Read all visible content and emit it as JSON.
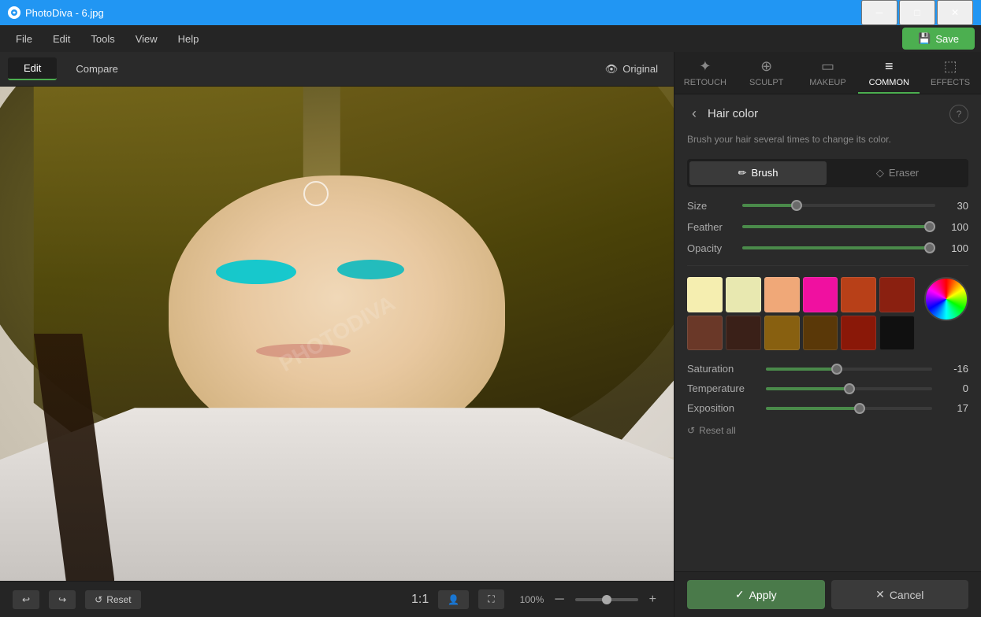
{
  "app": {
    "title": "PhotoDiva - 6.jpg",
    "icon": "photo-diva-icon"
  },
  "titlebar": {
    "title": "PhotoDiva - 6.jpg",
    "minimize_label": "─",
    "restore_label": "□",
    "close_label": "✕"
  },
  "menubar": {
    "items": [
      "File",
      "Edit",
      "Tools",
      "View",
      "Help"
    ],
    "save_label": "Save"
  },
  "canvas_toolbar": {
    "edit_tab": "Edit",
    "compare_tab": "Compare",
    "original_label": "Original"
  },
  "bottom_toolbar": {
    "undo_label": "↩",
    "redo_label": "↪",
    "reset_label": "Reset",
    "zoom_ratio": "1:1",
    "zoom_percent": "100%",
    "zoom_in": "+",
    "zoom_out": "─"
  },
  "right_panel": {
    "tabs": [
      {
        "id": "retouch",
        "label": "RETOUCH",
        "icon": "✦"
      },
      {
        "id": "sculpt",
        "label": "SCULPT",
        "icon": "⊕"
      },
      {
        "id": "makeup",
        "label": "MAKEUP",
        "icon": "⬜"
      },
      {
        "id": "common",
        "label": "COMMON",
        "icon": "≡"
      },
      {
        "id": "effects",
        "label": "EFFECTS",
        "icon": "⬚"
      }
    ],
    "active_tab": "common",
    "panel_title": "Hair color",
    "panel_desc": "Brush your hair several times to change its color.",
    "brush_label": "Brush",
    "eraser_label": "Eraser",
    "size_label": "Size",
    "size_value": "30",
    "size_fill": "27%",
    "feather_label": "Feather",
    "feather_value": "100",
    "feather_fill": "100%",
    "opacity_label": "Opacity",
    "opacity_value": "100",
    "opacity_fill": "100%",
    "swatches": [
      "#f5eeb0",
      "#e8e8b0",
      "#f0a878",
      "#f010a0",
      "#b84018",
      "#8a2010",
      "#6a3828",
      "#3a2018",
      "#886010",
      "#5a3808",
      "#8a1808",
      "#101010"
    ],
    "saturation_label": "Saturation",
    "saturation_value": "-16",
    "saturation_fill": "48%",
    "temperature_label": "Temperature",
    "temperature_value": "0",
    "temperature_fill": "50%",
    "exposition_label": "Exposition",
    "exposition_value": "17",
    "exposition_fill": "55%",
    "reset_all_label": "Reset all",
    "apply_label": "Apply",
    "cancel_label": "Cancel",
    "help_label": "?"
  },
  "watermark": {
    "text": "PHOTODIVA"
  }
}
